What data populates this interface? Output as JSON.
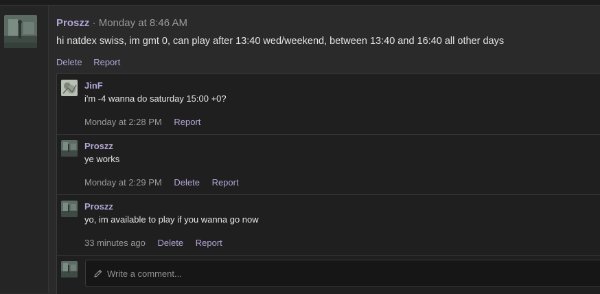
{
  "post": {
    "author": "Proszz",
    "separator": " · ",
    "timestamp": "Monday at 8:46 AM",
    "text": "hi natdex swiss, im gmt 0, can play after 13:40 wed/weekend, between 13:40 and 16:40 all other days",
    "actions": {
      "delete": "Delete",
      "report": "Report"
    }
  },
  "comments": [
    {
      "author": "JinF",
      "text": "i'm -4 wanna do saturday 15:00 +0?",
      "time": "Monday at 2:28 PM",
      "delete": null,
      "report": "Report"
    },
    {
      "author": "Proszz",
      "text": "ye works",
      "time": "Monday at 2:29 PM",
      "delete": "Delete",
      "report": "Report"
    },
    {
      "author": "Proszz",
      "text": "yo, im available to play if you wanna go now",
      "time": "33 minutes ago",
      "delete": "Delete",
      "report": "Report"
    }
  ],
  "composer": {
    "placeholder": "Write a comment..."
  },
  "icons": {
    "pencil": "pencil-icon"
  },
  "colors": {
    "username": "#b4a7d6",
    "link": "#b4a7d6",
    "text": "#e6e6e6",
    "meta": "#9a9a9a"
  }
}
